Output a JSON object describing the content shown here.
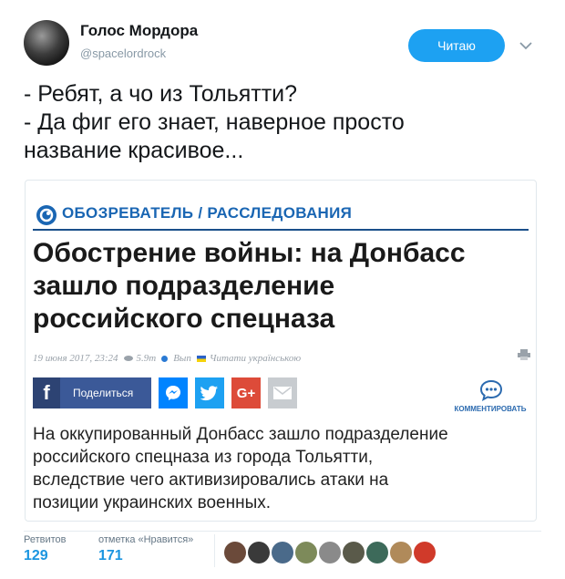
{
  "tweet": {
    "display_name": "Голос Мордора",
    "handle": "@spacelordrock",
    "follow_label": "Читаю",
    "text_lines": [
      "- Ребят, а чо из Тольятти?",
      "- Да фиг его знает, наверное просто",
      "название красивое..."
    ]
  },
  "card": {
    "logo_text": "ОБОЗРЕВАТЕЛЬ / РАССЛЕДОВАНИЯ",
    "headline_lines": [
      "Обострение войны: на Донбасс",
      "зашло подразделение",
      "российского спецназа"
    ],
    "meta": {
      "date": "19 июня 2017, 23:24",
      "views": "5.9т",
      "comments": "Вып",
      "language_link": "Читати українською"
    },
    "share": {
      "facebook_label": "Поделиться",
      "gplus_label": "G+",
      "comment_label": "КОММЕНТИРОВАТЬ"
    },
    "body_lines": [
      "На оккупированный Донбасс зашло подразделение",
      "российского спецназа из города Тольятти,",
      "вследствие чего активизировались атаки на",
      "позиции украинских военных."
    ]
  },
  "stats": {
    "retweets_label": "Ретвитов",
    "retweets_value": "129",
    "likes_label": "отметка «Нравится»",
    "likes_value": "171"
  },
  "colors": {
    "twitter_blue": "#1da1f2",
    "stat_blue": "#1b95e0",
    "obozrevatel_blue": "#1a66b3",
    "facebook": "#3b5998",
    "messenger": "#0084ff",
    "twitter_share": "#1da1f2",
    "gplus": "#dd4b39",
    "email": "#c8ccd0"
  },
  "likers": [
    {
      "icon": "avatar-icon",
      "color": "#6b4a3a"
    },
    {
      "icon": "avatar-icon",
      "color": "#3a3a3a"
    },
    {
      "icon": "avatar-icon",
      "color": "#4a6a8a"
    },
    {
      "icon": "avatar-icon",
      "color": "#7d8a5a"
    },
    {
      "icon": "avatar-icon",
      "color": "#8a8a8a"
    },
    {
      "icon": "avatar-icon",
      "color": "#5a5a4a"
    },
    {
      "icon": "avatar-icon",
      "color": "#3d6a5a"
    },
    {
      "icon": "avatar-icon",
      "color": "#b08a5a"
    },
    {
      "icon": "avatar-icon",
      "color": "#d03a2a"
    }
  ]
}
